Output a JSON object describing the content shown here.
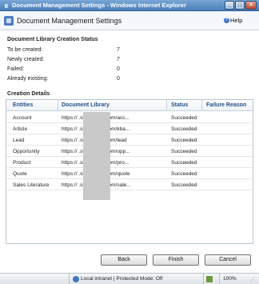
{
  "window": {
    "title": "Document Management Settings - Windows Internet Explorer",
    "icon": "ie-icon"
  },
  "header": {
    "title": "Document Management Settings",
    "help_label": "Help"
  },
  "status": {
    "section_title": "Document Library Creation Status",
    "rows": [
      {
        "label": "To be created:",
        "value": "7"
      },
      {
        "label": "Newly created:",
        "value": "7"
      },
      {
        "label": "Failed:",
        "value": "0"
      },
      {
        "label": "Already existing:",
        "value": "0"
      }
    ]
  },
  "details": {
    "section_title": "Creation Details",
    "columns": [
      "Entities",
      "Document Library",
      "Status",
      "Failure Reason"
    ],
    "rows": [
      {
        "entity": "Account",
        "library": "https://          .sharepoint.com/acc...",
        "status": "Succeeded",
        "reason": ""
      },
      {
        "entity": "Article",
        "library": "https://          .sharepoint.com/kba...",
        "status": "Succeeded",
        "reason": ""
      },
      {
        "entity": "Lead",
        "library": "https://          .sharepoint.com/lead",
        "status": "Succeeded",
        "reason": ""
      },
      {
        "entity": "Opportunity",
        "library": "https://          .sharepoint.com/opp...",
        "status": "Succeeded",
        "reason": ""
      },
      {
        "entity": "Product",
        "library": "https://          .sharepoint.com/pro...",
        "status": "Succeeded",
        "reason": ""
      },
      {
        "entity": "Quote",
        "library": "https://          .sharepoint.com/quote",
        "status": "Succeeded",
        "reason": ""
      },
      {
        "entity": "Sales Literature",
        "library": "https://          .sharepoint.com/sale...",
        "status": "Succeeded",
        "reason": ""
      }
    ]
  },
  "buttons": {
    "back": "Back",
    "finish": "Finish",
    "cancel": "Cancel"
  },
  "statusbar": {
    "zone": "Local intranet | Protected Mode: Off",
    "zoom": "100%"
  }
}
